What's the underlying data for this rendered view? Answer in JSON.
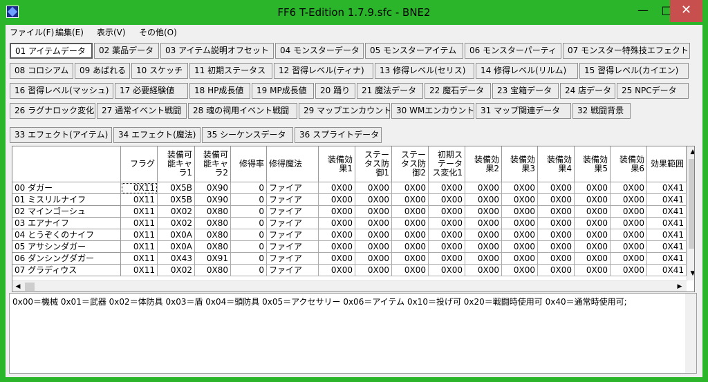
{
  "window": {
    "title": "FF6 T-Edition 1.7.9.sfc - BNE2"
  },
  "menu": [
    "ファイル(F)",
    "編集(E)",
    "表示(V)",
    "その他(O)"
  ],
  "tabs": [
    "01 アイテムデータ",
    "02 薬品データ",
    "03 アイテム説明オフセット",
    "04 モンスターデータ",
    "05 モンスターアイテム",
    "06 モンスターパーティ",
    "07 モンスター特殊技エフェクト",
    "08 コロシアム",
    "09 あばれる",
    "10 スケッチ",
    "11 初期ステータス",
    "12 習得レベル(ティナ)",
    "13 修得レベル(セリス)",
    "14 修得レベル(リルム)",
    "15 習得レベル(カイエン)",
    "16 習得レベル(マッシュ)",
    "17 必要経験値",
    "18 HP成長値",
    "19 MP成長値",
    "20 踊り",
    "21 魔法データ",
    "22 魔石データ",
    "23 宝箱データ",
    "24 店データ",
    "25 NPCデータ",
    "26 ラグナロック変化",
    "27 通常イベント戦闘",
    "28 魂の祠用イベント戦闘",
    "29 マップエンカウント",
    "30 WMエンカウント",
    "31 マップ関連データ",
    "32 戦闘背景",
    "33 エフェクト(アイテム)",
    "34 エフェクト(魔法)",
    "35 シーケンスデータ",
    "36 スプライトデータ"
  ],
  "grid": {
    "headers": [
      "",
      "フラグ",
      "装備可能キャラ1",
      "装備可能キャラ2",
      "修得率",
      "修得魔法",
      "装備効果1",
      "ステータス防御1",
      "ステータス防御2",
      "初期ステータス変化1",
      "装備効果2",
      "装備効果3",
      "装備効果4",
      "装備効果5",
      "装備効果6",
      "効果範囲"
    ],
    "rows": [
      [
        "00 ダガー",
        "0X11",
        "0X5B",
        "0X90",
        "0",
        "ファイア",
        "0X00",
        "0X00",
        "0X00",
        "0X00",
        "0X00",
        "0X00",
        "0X00",
        "0X00",
        "0X00",
        "0X41"
      ],
      [
        "01 ミスリルナイフ",
        "0X11",
        "0X5B",
        "0X90",
        "0",
        "ファイア",
        "0X00",
        "0X00",
        "0X00",
        "0X00",
        "0X00",
        "0X00",
        "0X00",
        "0X00",
        "0X00",
        "0X41"
      ],
      [
        "02 マインゴーシュ",
        "0X11",
        "0X02",
        "0X80",
        "0",
        "ファイア",
        "0X00",
        "0X00",
        "0X00",
        "0X00",
        "0X00",
        "0X00",
        "0X00",
        "0X00",
        "0X00",
        "0X41"
      ],
      [
        "03 エアナイフ",
        "0X11",
        "0X02",
        "0X80",
        "0",
        "ファイア",
        "0X00",
        "0X00",
        "0X00",
        "0X00",
        "0X00",
        "0X00",
        "0X00",
        "0X00",
        "0X00",
        "0X41"
      ],
      [
        "04 とうぞくのナイフ",
        "0X11",
        "0X0A",
        "0X80",
        "0",
        "ファイア",
        "0X00",
        "0X00",
        "0X00",
        "0X00",
        "0X00",
        "0X00",
        "0X00",
        "0X00",
        "0X00",
        "0X41"
      ],
      [
        "05 アサシンダガー",
        "0X11",
        "0X0A",
        "0X80",
        "0",
        "ファイア",
        "0X00",
        "0X00",
        "0X00",
        "0X00",
        "0X00",
        "0X00",
        "0X00",
        "0X00",
        "0X00",
        "0X41"
      ],
      [
        "06 ダンシングダガー",
        "0X11",
        "0X43",
        "0X91",
        "0",
        "ファイア",
        "0X00",
        "0X00",
        "0X00",
        "0X00",
        "0X00",
        "0X00",
        "0X00",
        "0X00",
        "0X00",
        "0X41"
      ],
      [
        "07 グラディウス",
        "0X11",
        "0X02",
        "0X80",
        "0",
        "ファイア",
        "0X00",
        "0X00",
        "0X00",
        "0X00",
        "0X00",
        "0X00",
        "0X00",
        "0X00",
        "0X00",
        "0X41"
      ]
    ]
  },
  "description": "0x00＝機械 0x01＝武器 0x02＝体防具 0x03＝盾 0x04＝頭防具 0x05＝アクセサリー 0x06＝アイテム 0x10＝投げ可 0x20＝戦闘時使用可 0x40＝通常時使用可;",
  "icons": {
    "scroll_up": "▲",
    "scroll_down": "▼",
    "scroll_left": "◀",
    "scroll_right": "▶",
    "minimize": "—",
    "maximize": "□",
    "close": "✕"
  },
  "colors": {
    "frame": "#2bb52b",
    "close": "#c7504f"
  }
}
